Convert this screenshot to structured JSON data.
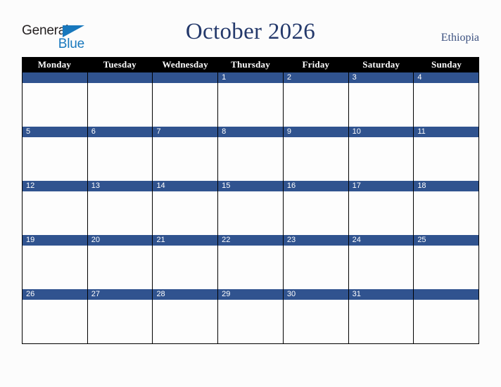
{
  "brand": {
    "line1": "General",
    "line2": "Blue",
    "triangle_icon": "blue-triangle-icon",
    "accent_color": "#1878bd",
    "text_color": "#231f20"
  },
  "header": {
    "title": "October 2026",
    "country": "Ethiopia",
    "title_color": "#24396b",
    "country_color": "#3c5180"
  },
  "calendar": {
    "day_headers": [
      "Monday",
      "Tuesday",
      "Wednesday",
      "Thursday",
      "Friday",
      "Saturday",
      "Sunday"
    ],
    "header_bg": "#000000",
    "header_text": "#ffffff",
    "date_bar_color": "#30538f",
    "date_text_color": "#ffffff",
    "cell_bg": "#fdfdfd",
    "border_color": "#000000",
    "weeks": [
      [
        "",
        "",
        "",
        "1",
        "2",
        "3",
        "4"
      ],
      [
        "5",
        "6",
        "7",
        "8",
        "9",
        "10",
        "11"
      ],
      [
        "12",
        "13",
        "14",
        "15",
        "16",
        "17",
        "18"
      ],
      [
        "19",
        "20",
        "21",
        "22",
        "23",
        "24",
        "25"
      ],
      [
        "26",
        "27",
        "28",
        "29",
        "30",
        "31",
        ""
      ]
    ]
  }
}
